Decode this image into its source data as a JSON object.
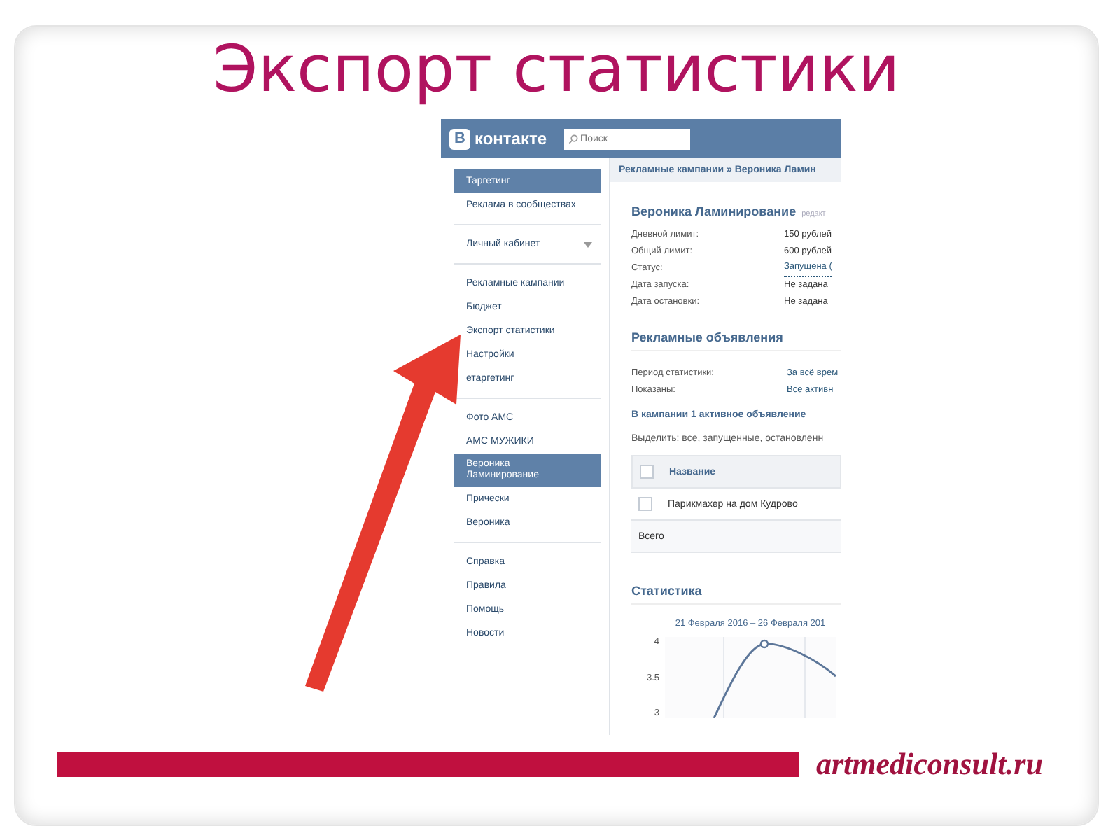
{
  "slide": {
    "title": "Экспорт статистики",
    "footer": "artmediconsult.ru"
  },
  "header": {
    "logo_letter": "В",
    "logo_text": "контакте",
    "search": {
      "placeholder": "Поиск"
    }
  },
  "sidebar": {
    "groups": [
      [
        {
          "label": "Таргетинг",
          "kind": "link",
          "selected": true
        },
        {
          "label": "Реклама в сообществах",
          "kind": "link",
          "selected": false
        }
      ],
      [
        {
          "label": "Личный кабинет",
          "kind": "dropdown",
          "selected": false
        }
      ],
      [
        {
          "label": "Рекламные кампании",
          "kind": "link",
          "selected": false
        },
        {
          "label": "Бюджет",
          "kind": "link",
          "selected": false
        },
        {
          "label": "Экспорт статистики",
          "kind": "link",
          "selected": false
        },
        {
          "label": "Настройки",
          "kind": "link",
          "selected": false
        },
        {
          "label": "етаргетинг",
          "kind": "link",
          "selected": false
        }
      ],
      [
        {
          "label": "Фото АМС",
          "kind": "link",
          "selected": false
        },
        {
          "label": "АМС МУЖИКИ",
          "kind": "link",
          "selected": false
        },
        {
          "label": "Вероника Ламинирование",
          "kind": "link",
          "selected": true
        },
        {
          "label": "Прически",
          "kind": "link",
          "selected": false
        },
        {
          "label": "Вероника",
          "kind": "link",
          "selected": false
        }
      ],
      [
        {
          "label": "Справка",
          "kind": "link",
          "selected": false
        },
        {
          "label": "Правила",
          "kind": "link",
          "selected": false
        },
        {
          "label": "Помощь",
          "kind": "link",
          "selected": false
        },
        {
          "label": "Новости",
          "kind": "link",
          "selected": false
        }
      ]
    ]
  },
  "breadcrumb": "Рекламные кампании » Вероника Ламин",
  "campaign": {
    "title": "Вероника Ламинирование",
    "edit": "редакт",
    "fields": [
      {
        "label": "Дневной лимит:",
        "value": "150 рублей",
        "kind": "text"
      },
      {
        "label": "Общий лимит:",
        "value": "600 рублей",
        "kind": "text"
      },
      {
        "label": "Статус:",
        "value": "Запущена (",
        "kind": "link"
      },
      {
        "label": "Дата запуска:",
        "value": "Не задана",
        "kind": "text"
      },
      {
        "label": "Дата остановки:",
        "value": "Не задана",
        "kind": "text"
      }
    ]
  },
  "ads": {
    "title": "Рекламные объявления",
    "fields": [
      {
        "label": "Период статистики:",
        "value": "За всё врем",
        "kind": "link"
      },
      {
        "label": "Показаны:",
        "value": "Все активн",
        "kind": "link"
      }
    ],
    "count": "В кампании 1 активное объявление",
    "select": "Выделить: все, запущенные, остановленн",
    "table": {
      "header": {
        "checked": false,
        "name": "Название"
      },
      "rows": [
        {
          "checked": false,
          "name": "Парикмахер на дом Кудрово"
        }
      ],
      "total": "Всего"
    }
  },
  "stats": {
    "title": "Статистика",
    "period": "21 Февраля 2016 – 26 Февраля 201",
    "y_ticks": [
      "4",
      "3.5",
      "3"
    ]
  }
}
